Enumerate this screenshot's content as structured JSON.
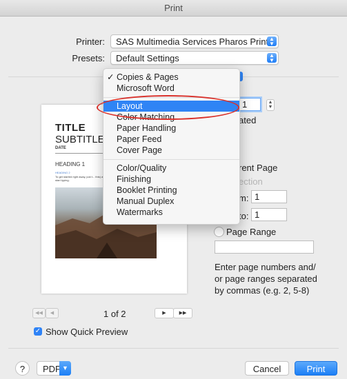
{
  "window": {
    "title": "Print"
  },
  "printer": {
    "label": "Printer:",
    "value": "SAS Multimedia Services Pharos Printer"
  },
  "presets": {
    "label": "Presets:",
    "value": "Default Settings"
  },
  "preview": {
    "doc_title": "TITLE",
    "doc_subtitle": "SUBTITLE",
    "doc_date": "DATE",
    "doc_heading": "HEADING 1",
    "doc_heading2": "HEADING 2",
    "doc_body": "To get started right away, just t... this) and start typing.",
    "page_indicator": "1 of 2",
    "first_label": "◀◀",
    "prev_label": "◀",
    "next_label": "▶",
    "last_label": "▶▶"
  },
  "show_quick_preview": {
    "label": "Show Quick Preview",
    "checked": true
  },
  "copies": {
    "value": "1",
    "collated_label": "ated"
  },
  "pages": {
    "current_label": "rent Page",
    "selection_label": "ection",
    "from_label": "m:",
    "from_value": "1",
    "to_label": "to:",
    "to_value": "1",
    "range_label": "Page Range",
    "range_value": "",
    "help_text_1": "Enter page numbers and/",
    "help_text_2": "or page ranges separated",
    "help_text_3": "by commas (e.g. 2, 5-8)"
  },
  "menu": {
    "items_group1": [
      "Copies & Pages",
      "Microsoft Word"
    ],
    "checked_item": "Copies & Pages",
    "items_group2": [
      "Layout",
      "Color Matching",
      "Paper Handling",
      "Paper Feed",
      "Cover Page"
    ],
    "selected_item": "Layout",
    "items_group3": [
      "Color/Quality",
      "Finishing",
      "Booklet Printing",
      "Manual Duplex",
      "Watermarks"
    ]
  },
  "bottom": {
    "help_label": "?",
    "pdf_label": "PDF",
    "cancel_label": "Cancel",
    "print_label": "Print"
  },
  "colors": {
    "accent": "#2f84f5",
    "highlight_ring": "#d9302a"
  }
}
